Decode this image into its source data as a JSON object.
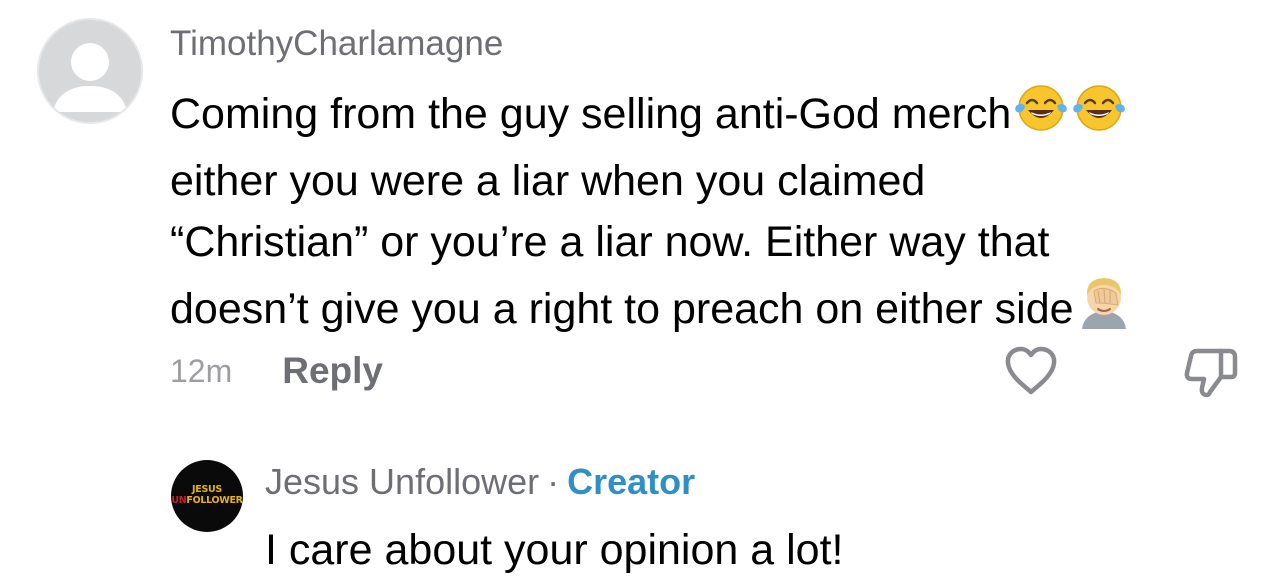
{
  "comment": {
    "username": "TimothyCharlamagne",
    "lines": [
      "Coming from the guy selling anti-God merch",
      "either you were a liar when you claimed",
      "“Christian” or you’re a liar now. Either way that",
      "doesn’t give you a right to preach on either side"
    ],
    "emojis": {
      "line1": [
        "face-with-tears-of-joy",
        "face-with-tears-of-joy"
      ],
      "line4": [
        "person-facepalming"
      ]
    },
    "timestamp": "12m",
    "reply_label": "Reply",
    "icons": {
      "like": "heart-outline-icon",
      "dislike": "thumbs-down-outline-icon"
    }
  },
  "reply": {
    "avatar_text": {
      "line1": "JESUS",
      "line2_prefix": "UN",
      "line2_rest": "FOLLOWER"
    },
    "author": "Jesus Unfollower",
    "separator": "·",
    "badge": "Creator",
    "text": "I care about your opinion a lot!"
  },
  "colors": {
    "username_gray": "#6e6f75",
    "timestamp_gray": "#9d9ea3",
    "creator_blue": "#2f8fc6",
    "logo_gold": "#e6b219",
    "logo_red": "#c8202a"
  }
}
